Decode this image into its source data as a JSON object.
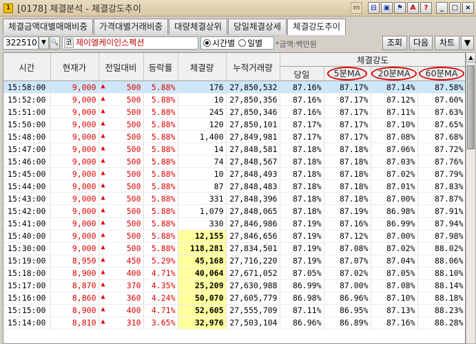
{
  "window": {
    "screen_no": "0178",
    "title": "[0178] 체결분석 - 체결강도추이",
    "title_buttons": [
      "m",
      "⊟",
      "▣",
      "⚑",
      "A",
      "?",
      "_",
      "□",
      "×"
    ]
  },
  "tabs": [
    "체결금액대별매매비중",
    "가격대별거래비중",
    "대량체결상위",
    "당일체결상세",
    "체결강도추이"
  ],
  "active_tab": 4,
  "toolbar": {
    "code": "322510",
    "market": "코",
    "stock_name": "제이엘케이인스펙션",
    "radio_time": "시간별",
    "radio_day": "일별",
    "unit_note": "*금액:백만원",
    "btn_query": "조회",
    "btn_next": "다음",
    "btn_chart": "차트",
    "btn_more": "▼"
  },
  "table": {
    "headers": {
      "time": "시간",
      "price": "현재가",
      "change": "전일대비",
      "rate": "등락률",
      "volume": "체결량",
      "cum_volume": "누적거래량",
      "strength_group": "체결강도",
      "today": "당일",
      "ma5": "5분MA",
      "ma20": "20분MA",
      "ma60": "60분MA"
    },
    "rows": [
      {
        "time": "15:58:00",
        "price": "9,000",
        "change": "500",
        "rate": "5.88%",
        "volume": "176",
        "cum": "27,850,532",
        "today": "87.16%",
        "ma5": "87.17%",
        "ma20": "87.14%",
        "ma60": "87.58%",
        "hl": false
      },
      {
        "time": "15:52:00",
        "price": "9,000",
        "change": "500",
        "rate": "5.88%",
        "volume": "10",
        "cum": "27,850,356",
        "today": "87.16%",
        "ma5": "87.17%",
        "ma20": "87.12%",
        "ma60": "87.60%",
        "hl": false
      },
      {
        "time": "15:51:00",
        "price": "9,000",
        "change": "500",
        "rate": "5.88%",
        "volume": "245",
        "cum": "27,850,346",
        "today": "87.16%",
        "ma5": "87.17%",
        "ma20": "87.11%",
        "ma60": "87.63%",
        "hl": false
      },
      {
        "time": "15:50:00",
        "price": "9,000",
        "change": "500",
        "rate": "5.88%",
        "volume": "120",
        "cum": "27,850,101",
        "today": "87.17%",
        "ma5": "87.17%",
        "ma20": "87.10%",
        "ma60": "87.65%",
        "hl": false
      },
      {
        "time": "15:48:00",
        "price": "9,000",
        "change": "500",
        "rate": "5.88%",
        "volume": "1,400",
        "cum": "27,849,981",
        "today": "87.17%",
        "ma5": "87.17%",
        "ma20": "87.08%",
        "ma60": "87.68%",
        "hl": false
      },
      {
        "time": "15:47:00",
        "price": "9,000",
        "change": "500",
        "rate": "5.88%",
        "volume": "14",
        "cum": "27,848,581",
        "today": "87.18%",
        "ma5": "87.18%",
        "ma20": "87.06%",
        "ma60": "87.72%",
        "hl": false
      },
      {
        "time": "15:46:00",
        "price": "9,000",
        "change": "500",
        "rate": "5.88%",
        "volume": "74",
        "cum": "27,848,567",
        "today": "87.18%",
        "ma5": "87.18%",
        "ma20": "87.03%",
        "ma60": "87.76%",
        "hl": false
      },
      {
        "time": "15:45:00",
        "price": "9,000",
        "change": "500",
        "rate": "5.88%",
        "volume": "10",
        "cum": "27,848,493",
        "today": "87.18%",
        "ma5": "87.18%",
        "ma20": "87.02%",
        "ma60": "87.79%",
        "hl": false
      },
      {
        "time": "15:44:00",
        "price": "9,000",
        "change": "500",
        "rate": "5.88%",
        "volume": "87",
        "cum": "27,848,483",
        "today": "87.18%",
        "ma5": "87.18%",
        "ma20": "87.01%",
        "ma60": "87.83%",
        "hl": false
      },
      {
        "time": "15:43:00",
        "price": "9,000",
        "change": "500",
        "rate": "5.88%",
        "volume": "331",
        "cum": "27,848,396",
        "today": "87.18%",
        "ma5": "87.18%",
        "ma20": "87.00%",
        "ma60": "87.87%",
        "hl": false
      },
      {
        "time": "15:42:00",
        "price": "9,000",
        "change": "500",
        "rate": "5.88%",
        "volume": "1,079",
        "cum": "27,848,065",
        "today": "87.18%",
        "ma5": "87.19%",
        "ma20": "86.98%",
        "ma60": "87.91%",
        "hl": false
      },
      {
        "time": "15:41:00",
        "price": "9,000",
        "change": "500",
        "rate": "5.88%",
        "volume": "330",
        "cum": "27,846,986",
        "today": "87.19%",
        "ma5": "87.16%",
        "ma20": "86.99%",
        "ma60": "87.94%",
        "hl": false
      },
      {
        "time": "15:40:00",
        "price": "9,000",
        "change": "500",
        "rate": "5.88%",
        "volume": "12,155",
        "cum": "27,846,656",
        "today": "87.19%",
        "ma5": "87.12%",
        "ma20": "87.00%",
        "ma60": "87.98%",
        "hl": true
      },
      {
        "time": "15:30:00",
        "price": "9,000",
        "change": "500",
        "rate": "5.88%",
        "volume": "118,281",
        "cum": "27,834,501",
        "today": "87.19%",
        "ma5": "87.08%",
        "ma20": "87.02%",
        "ma60": "88.02%",
        "hl": true
      },
      {
        "time": "15:19:00",
        "price": "8,950",
        "change": "450",
        "rate": "5.29%",
        "volume": "45,168",
        "cum": "27,716,220",
        "today": "87.19%",
        "ma5": "87.07%",
        "ma20": "87.04%",
        "ma60": "88.06%",
        "hl": true
      },
      {
        "time": "15:18:00",
        "price": "8,900",
        "change": "400",
        "rate": "4.71%",
        "volume": "40,064",
        "cum": "27,671,052",
        "today": "87.05%",
        "ma5": "87.02%",
        "ma20": "87.05%",
        "ma60": "88.10%",
        "hl": true
      },
      {
        "time": "15:17:00",
        "price": "8,870",
        "change": "370",
        "rate": "4.35%",
        "volume": "25,209",
        "cum": "27,630,988",
        "today": "86.99%",
        "ma5": "87.00%",
        "ma20": "87.08%",
        "ma60": "88.14%",
        "hl": true
      },
      {
        "time": "15:16:00",
        "price": "8,860",
        "change": "360",
        "rate": "4.24%",
        "volume": "50,070",
        "cum": "27,605,779",
        "today": "86.98%",
        "ma5": "86.96%",
        "ma20": "87.10%",
        "ma60": "88.18%",
        "hl": true
      },
      {
        "time": "15:15:00",
        "price": "8,900",
        "change": "400",
        "rate": "4.71%",
        "volume": "52,605",
        "cum": "27,555,709",
        "today": "87.11%",
        "ma5": "86.95%",
        "ma20": "87.13%",
        "ma60": "88.23%",
        "hl": true
      },
      {
        "time": "15:14:00",
        "price": "8,810",
        "change": "310",
        "rate": "3.65%",
        "volume": "32,976",
        "cum": "27,503,104",
        "today": "86.96%",
        "ma5": "86.89%",
        "ma20": "87.16%",
        "ma60": "88.28%",
        "hl": true
      }
    ]
  },
  "colors": {
    "up": "#e00000",
    "selected_row": "#cfe6fa",
    "volume_highlight": "#ffff9e",
    "annotation_circle": "#e00000"
  }
}
